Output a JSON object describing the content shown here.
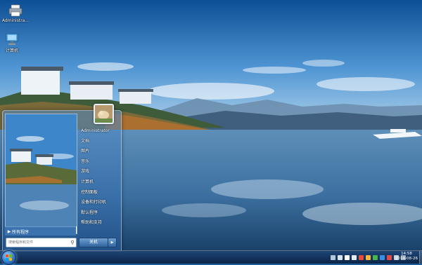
{
  "desktop": {
    "icons": [
      {
        "label": "Administra...",
        "icon": "printer-icon"
      },
      {
        "label": "计算机",
        "icon": "computer-icon"
      }
    ]
  },
  "start_menu": {
    "all_programs_label": "所有程序",
    "search": {
      "placeholder": "搜索程序和文件"
    },
    "user_name": "Administrator",
    "right_items": [
      "文档",
      "图片",
      "音乐",
      "游戏",
      "计算机",
      "控制面板",
      "设备和打印机",
      "默认程序",
      "帮助和支持"
    ],
    "shutdown_label": "关机"
  },
  "taskbar": {
    "clock_time": "14:58",
    "clock_date": "2014-08-26",
    "colors": {
      "accent": "#2a6fc0"
    }
  }
}
